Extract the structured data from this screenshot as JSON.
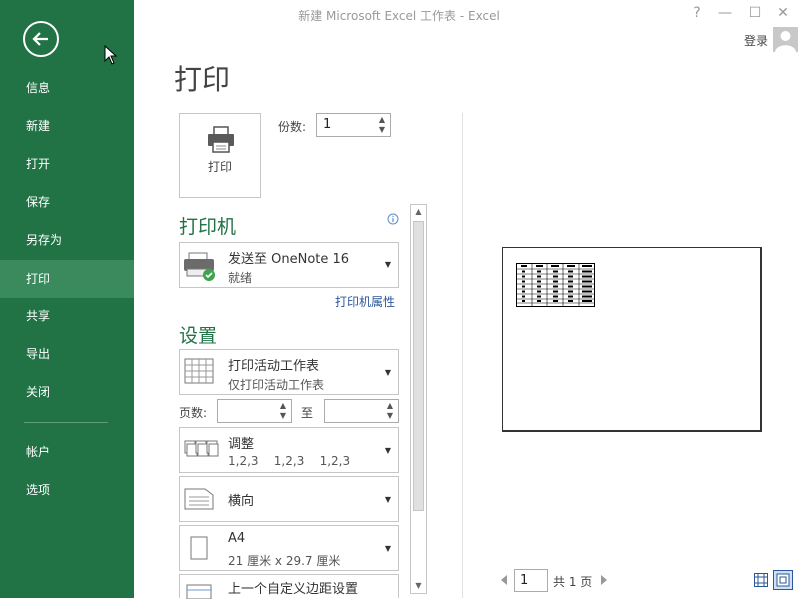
{
  "window": {
    "title": "新建 Microsoft Excel 工作表 - Excel",
    "help": "?",
    "minimize": "—",
    "restore": "☐",
    "close": "✕",
    "signin": "登录"
  },
  "sidebar": {
    "items": [
      {
        "label": "信息"
      },
      {
        "label": "新建"
      },
      {
        "label": "打开"
      },
      {
        "label": "保存"
      },
      {
        "label": "另存为"
      },
      {
        "label": "打印",
        "active": true
      },
      {
        "label": "共享"
      },
      {
        "label": "导出"
      },
      {
        "label": "关闭"
      },
      {
        "label": "帐户"
      },
      {
        "label": "选项"
      }
    ]
  },
  "main": {
    "title": "打印",
    "print_button": "打印",
    "copies_label": "份数:",
    "copies_value": "1",
    "printer_heading": "打印机",
    "printer_name": "发送至 OneNote 16",
    "printer_status": "就绪",
    "printer_properties": "打印机属性",
    "settings_heading": "设置",
    "print_what_title": "打印活动工作表",
    "print_what_sub": "仅打印活动工作表",
    "pages_label": "页数:",
    "pages_to_label": "至",
    "pages_from": "",
    "pages_to": "",
    "collate_title": "调整",
    "collate_sub": "1,2,3    1,2,3    1,2,3",
    "orientation": "横向",
    "paper_title": "A4",
    "paper_sub": "21 厘米 x 29.7 厘米",
    "margins_title": "上一个自定义边距设置"
  },
  "preview": {
    "page_value": "1",
    "total_pages": "共 1 页"
  },
  "colors": {
    "sidebar": "#217346",
    "sidebar_active": "#3a8a5e",
    "accent": "#217346",
    "link": "#2b579a"
  }
}
